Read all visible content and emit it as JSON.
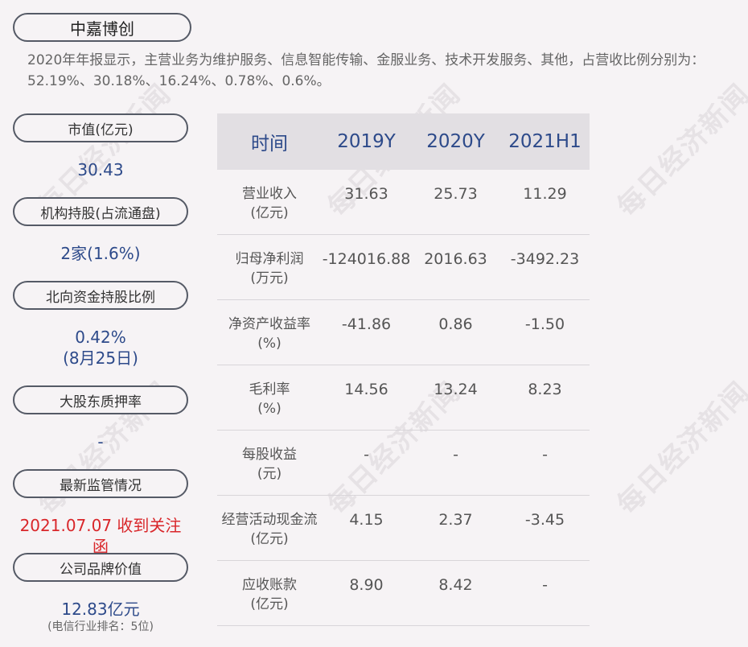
{
  "company": "中嘉博创",
  "intro": "2020年年报显示，主营业务为维护服务、信息智能传输、金服业务、技术开发服务、其他，占营收比例分别为：52.19%、30.18%、16.24%、0.78%、0.6%。",
  "left": {
    "market_cap_label": "市值(亿元)",
    "market_cap_value": "30.43",
    "inst_label": "机构持股(占流通盘)",
    "inst_value": "2家(1.6%)",
    "north_label": "北向资金持股比例",
    "north_value": "0.42%",
    "north_date": "(8月25日)",
    "pledge_label": "大股东质押率",
    "pledge_value": "-",
    "reg_label": "最新监管情况",
    "reg_value": "2021.07.07 收到关注函",
    "brand_label": "公司品牌价值",
    "brand_value": "12.83亿元",
    "brand_rank": "(电信行业排名：5位)"
  },
  "table": {
    "headers": [
      "时间",
      "2019Y",
      "2020Y",
      "2021H1"
    ],
    "rows": [
      {
        "label1": "营业收入",
        "label2": "(亿元)",
        "v": [
          "31.63",
          "25.73",
          "11.29"
        ]
      },
      {
        "label1": "归母净利润",
        "label2": "(万元)",
        "v": [
          "-124016.88",
          "2016.63",
          "-3492.23"
        ]
      },
      {
        "label1": "净资产收益率",
        "label2": "(%)",
        "v": [
          "-41.86",
          "0.86",
          "-1.50"
        ]
      },
      {
        "label1": "毛利率",
        "label2": "(%)",
        "v": [
          "14.56",
          "13.24",
          "8.23"
        ]
      },
      {
        "label1": "每股收益",
        "label2": "(元)",
        "v": [
          "-",
          "-",
          "-"
        ]
      },
      {
        "label1": "经营活动现金流",
        "label2": "(亿元)",
        "v": [
          "4.15",
          "2.37",
          "-3.45"
        ]
      },
      {
        "label1": "应收账款",
        "label2": "(亿元)",
        "v": [
          "8.90",
          "8.42",
          "-"
        ]
      }
    ]
  },
  "watermark": "每日经济新闻"
}
